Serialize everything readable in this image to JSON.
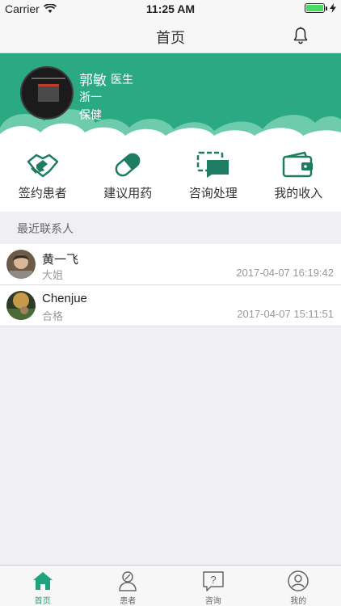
{
  "status_bar": {
    "carrier": "Carrier",
    "time": "11:25 AM",
    "battery_level": 1.0
  },
  "nav": {
    "title": "首页"
  },
  "profile": {
    "name": "郭敏",
    "title": "医生",
    "line1": "浙一",
    "line2": "保健"
  },
  "shortcuts": [
    {
      "label": "签约患者",
      "icon": "handshake-icon"
    },
    {
      "label": "建议用药",
      "icon": "pill-icon"
    },
    {
      "label": "咨询处理",
      "icon": "chat-icon"
    },
    {
      "label": "我的收入",
      "icon": "wallet-icon"
    }
  ],
  "recent": {
    "title": "最近联系人",
    "contacts": [
      {
        "name": "黄一飞",
        "subtitle": "大姐",
        "time": "2017-04-07 16:19:42"
      },
      {
        "name": "Chenjue",
        "subtitle": "合格",
        "time": "2017-04-07 15:11:51"
      }
    ]
  },
  "tabs": [
    {
      "label": "首页",
      "icon": "home-icon",
      "active": true
    },
    {
      "label": "患者",
      "icon": "patient-icon",
      "active": false
    },
    {
      "label": "咨询",
      "icon": "question-icon",
      "active": false
    },
    {
      "label": "我的",
      "icon": "profile-icon",
      "active": false
    }
  ],
  "colors": {
    "accent": "#2aa982",
    "tab_active": "#1fa37e",
    "icon_dark": "#1e7c62"
  }
}
